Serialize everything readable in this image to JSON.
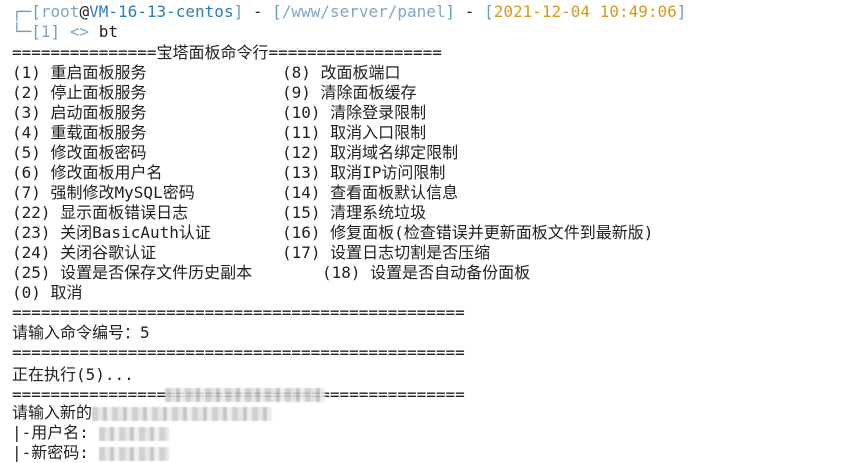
{
  "prompt": {
    "user": "root",
    "at": "@",
    "host": "VM-16-13-centos",
    "path": "/www/server/panel",
    "datetime": "2021-12-04 10:49:06",
    "sep": " - ",
    "index": "1",
    "arrow": "<>",
    "command": "bt"
  },
  "banner": "===============宝塔面板命令行==================",
  "menu_left": [
    "(1) 重启面板服务",
    "(2) 停止面板服务",
    "(3) 启动面板服务",
    "(4) 重载面板服务",
    "(5) 修改面板密码",
    "(6) 修改面板用户名",
    "(7) 强制修改MySQL密码",
    "(22) 显示面板错误日志",
    "(23) 关闭BasicAuth认证",
    "(24) 关闭谷歌认证",
    "(25) 设置是否保存文件历史副本",
    "(0) 取消"
  ],
  "menu_right": [
    "(8) 改面板端口",
    "(9) 清除面板缓存",
    "(10) 清除登录限制",
    "(11) 取消入口限制",
    "(12) 取消域名绑定限制",
    "(13) 取消IP访问限制",
    "(14) 查看面板默认信息",
    "(15) 清理系统垃圾",
    "(16) 修复面板(检查错误并更新面板文件到最新版)",
    "(17) 设置日志切割是否压缩",
    "(18) 设置是否自动备份面板"
  ],
  "separator": "===============================================",
  "input_prompt": "请输入命令编号：5",
  "executing": "正在执行(5)...",
  "new_prompt_label": "请输入新的",
  "username_label": "|-用户名: ",
  "password_label": "|-新密码: "
}
